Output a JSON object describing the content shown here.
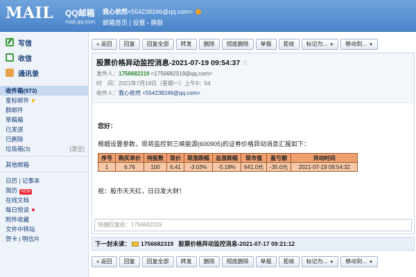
{
  "header": {
    "logo_text": "MAIL",
    "brand": "QQ邮箱",
    "brand_url": "mail.qq.com",
    "user_name": "我心依然",
    "user_email": "<554238246@qq.com>",
    "links": "邮箱首页 | 设置 - 换肤"
  },
  "sidebar": {
    "write": "写信",
    "receive": "收信",
    "contacts": "通讯录",
    "items": [
      {
        "label": "收件箱(973)"
      },
      {
        "label": "星标邮件"
      },
      {
        "label": "群邮件"
      },
      {
        "label": "草稿箱"
      },
      {
        "label": "已发送"
      },
      {
        "label": "已删除"
      },
      {
        "label": "垃圾箱(3)",
        "extra": "[清空]"
      },
      {
        "label": "其他邮箱"
      },
      {
        "label": "日历 | 记事本"
      },
      {
        "label": "简历",
        "badge": "NEW"
      },
      {
        "label": "在线文档"
      },
      {
        "label": "每日悦读"
      },
      {
        "label": "附件收藏"
      },
      {
        "label": "文件中转站"
      },
      {
        "label": "贺卡 | 明信片"
      }
    ]
  },
  "toolbar": {
    "back": "« 返回",
    "reply": "回复",
    "reply_all": "回复全部",
    "forward": "转发",
    "delete": "删除",
    "delete_perm": "彻底删除",
    "report": "举报",
    "reject": "拒收",
    "mark_as": "标记为...",
    "move_to": "移动到..."
  },
  "mail": {
    "subject": "股票价格异动监控消息-2021-07-19 09:54:37",
    "sender_label": "发件人：",
    "sender_name": "1756682319",
    "sender_addr": "<1756682319@qq.com>",
    "time_label": "时　间：",
    "time_value": "2021年7月19日（星期一）上午9：54",
    "recipient_label": "收件人：",
    "recipient_value": "我心依然 <554238246@qq.com>",
    "greeting": "您好：",
    "intro": "根据设置参数，现将监控到三峡能源(600905)的证券价格异动消息汇报如下：",
    "table": {
      "headers": [
        "序号",
        "购买单价",
        "持股数",
        "现价",
        "现涨跌幅",
        "总涨跌幅",
        "现市值",
        "盈亏额",
        "异动时间"
      ],
      "rows": [
        [
          "1",
          "6.76",
          "100",
          "6.41",
          "-3.03%",
          "-5.18%",
          "641.0元",
          "-35.0元",
          "2021-07-19 09:54:32"
        ]
      ]
    },
    "wish": "祝：股市天天红，日日发大财！"
  },
  "quick_reply": {
    "placeholder": "快捷回复给：1756682319"
  },
  "next_mail": {
    "label": "下一封未读：",
    "sender": "1756682319",
    "subject": "股票价格异动监控消息-2021-07-17 09:21:12"
  }
}
